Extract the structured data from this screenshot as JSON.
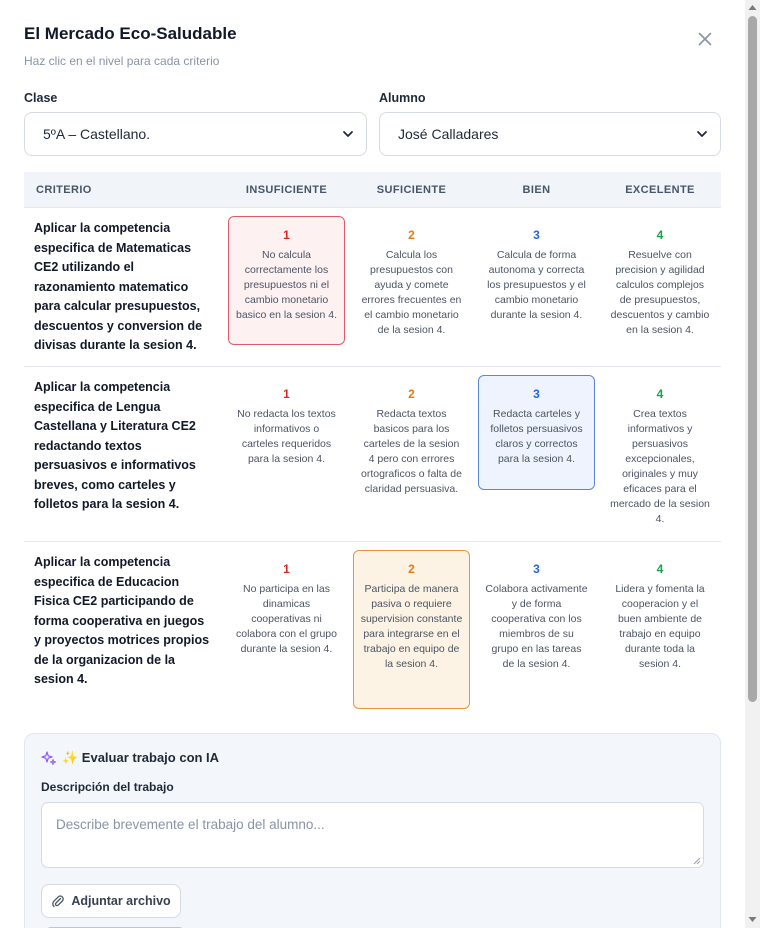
{
  "modal": {
    "title": "El Mercado Eco-Saludable",
    "subtitle": "Haz clic en el nivel para cada criterio"
  },
  "filters": {
    "clase_label": "Clase",
    "clase_value": "5ºA – Castellano.",
    "alumno_label": "Alumno",
    "alumno_value": "José Calladares"
  },
  "rubric": {
    "headers": [
      "CRITERIO",
      "INSUFICIENTE",
      "SUFICIENTE",
      "BIEN",
      "EXCELENTE"
    ],
    "rows": [
      {
        "criterion": "Aplicar la competencia especifica de Matematicas CE2 utilizando el razonamiento matematico para calcular presupuestos, descuentos y conversion de divisas durante la sesion 4.",
        "selected": 1,
        "levels": [
          {
            "num": "1",
            "desc": "No calcula correctamente los presupuestos ni el cambio monetario basico en la sesion 4."
          },
          {
            "num": "2",
            "desc": "Calcula los presupuestos con ayuda y comete errores frecuentes en el cambio monetario de la sesion 4."
          },
          {
            "num": "3",
            "desc": "Calcula de forma autonoma y correcta los presupuestos y el cambio monetario durante la sesion 4."
          },
          {
            "num": "4",
            "desc": "Resuelve con precision y agilidad calculos complejos de presupuestos, descuentos y cambio en la sesion 4."
          }
        ]
      },
      {
        "criterion": "Aplicar la competencia especifica de Lengua Castellana y Literatura CE2 redactando textos persuasivos e informativos breves, como carteles y folletos para la sesion 4.",
        "selected": 3,
        "levels": [
          {
            "num": "1",
            "desc": "No redacta los textos informativos o carteles requeridos para la sesion 4."
          },
          {
            "num": "2",
            "desc": "Redacta textos basicos para los carteles de la sesion 4 pero con errores ortograficos o falta de claridad persuasiva."
          },
          {
            "num": "3",
            "desc": "Redacta carteles y folletos persuasivos claros y correctos para la sesion 4."
          },
          {
            "num": "4",
            "desc": "Crea textos informativos y persuasivos excepcionales, originales y muy eficaces para el mercado de la sesion 4."
          }
        ]
      },
      {
        "criterion": "Aplicar la competencia especifica de Educacion Fisica CE2 participando de forma cooperativa en juegos y proyectos motrices propios de la organizacion de la sesion 4.",
        "selected": 2,
        "levels": [
          {
            "num": "1",
            "desc": "No participa en las dinamicas cooperativas ni colabora con el grupo durante la sesion 4."
          },
          {
            "num": "2",
            "desc": "Participa de manera pasiva o requiere supervision constante para integrarse en el trabajo en equipo de la sesion 4."
          },
          {
            "num": "3",
            "desc": "Colabora activamente y de forma cooperativa con los miembros de su grupo en las tareas de la sesion 4."
          },
          {
            "num": "4",
            "desc": "Lidera y fomenta la cooperacion y el buen ambiente de trabajo en equipo durante toda la sesion 4."
          }
        ]
      }
    ]
  },
  "ai": {
    "title": "✨ Evaluar trabajo con IA",
    "desc_label": "Descripción del trabajo",
    "placeholder": "Describe brevemente el trabajo del alumno...",
    "attach_label": "Adjuntar archivo"
  },
  "colors": {
    "insuficiente": "#dc2626",
    "suficiente": "#ea7a13",
    "bien": "#2563eb",
    "excelente": "#16a34a"
  }
}
